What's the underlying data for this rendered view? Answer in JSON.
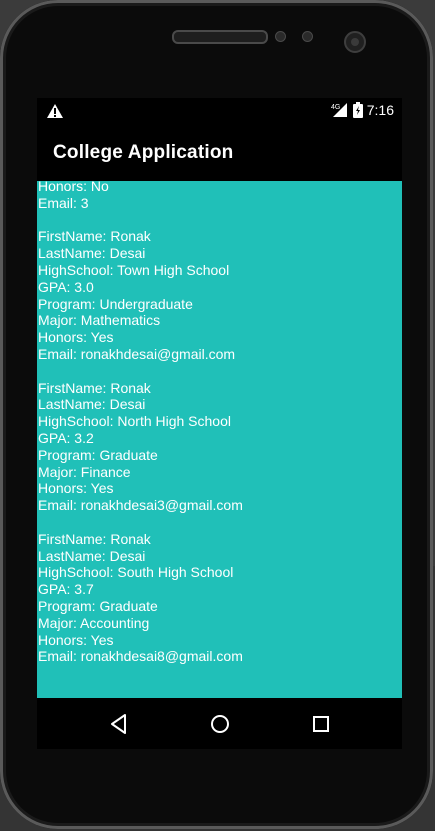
{
  "status_bar": {
    "network": "4G",
    "time": "7:16"
  },
  "app_bar": {
    "title": "College Application"
  },
  "records": [
    {
      "lines": [
        "Honors: No",
        "Email: 3"
      ]
    },
    {
      "lines": [
        "FirstName: Ronak",
        "LastName: Desai",
        "HighSchool: Town High School",
        "GPA: 3.0",
        "Program: Undergraduate",
        "Major: Mathematics",
        "Honors: Yes",
        "Email: ronakhdesai@gmail.com"
      ]
    },
    {
      "lines": [
        "FirstName: Ronak",
        "LastName: Desai",
        "HighSchool: North High School",
        "GPA: 3.2",
        "Program: Graduate",
        "Major: Finance",
        "Honors: Yes",
        "Email: ronakhdesai3@gmail.com"
      ]
    },
    {
      "lines": [
        "FirstName: Ronak",
        "LastName: Desai",
        "HighSchool: South High School",
        "GPA: 3.7",
        "Program: Graduate",
        "Major: Accounting",
        "Honors: Yes",
        "Email: ronakhdesai8@gmail.com"
      ]
    }
  ],
  "colors": {
    "content_background": "#20c0b8",
    "bars": "#000000",
    "text": "#ffffff"
  },
  "icons": {
    "warning": "warning-icon",
    "signal": "signal-icon",
    "battery": "battery-icon",
    "back": "back-icon",
    "home": "home-icon",
    "recents": "recents-icon"
  }
}
